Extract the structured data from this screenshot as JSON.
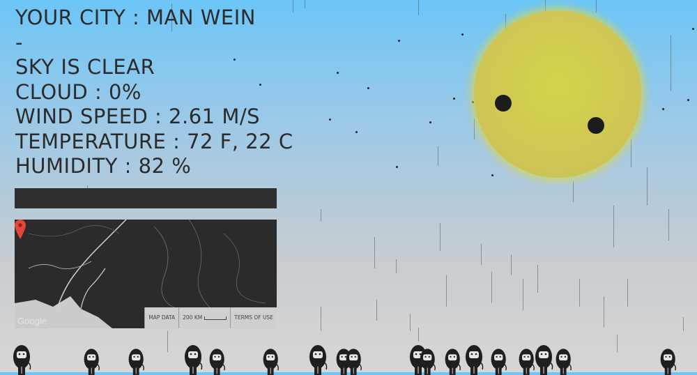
{
  "weather": {
    "city_line": "YOUR CITY : MAN WEIN",
    "separator": "-",
    "sky": "SKY IS CLEAR",
    "cloud": "CLOUD : 0%",
    "wind": "WIND SPEED : 2.61 M/S",
    "temperature": "TEMPERATURE : 72 F, 22 C",
    "humidity": "HUMIDITY : 82 %"
  },
  "map": {
    "logo": "Google",
    "map_data_label": "MAP DATA",
    "scale_label": "200 KM",
    "terms_label": "TERMS OF USE"
  },
  "colors": {
    "sky_top": "#6cc6f7",
    "sun": "#cec654",
    "panel": "#2f2f2f"
  }
}
